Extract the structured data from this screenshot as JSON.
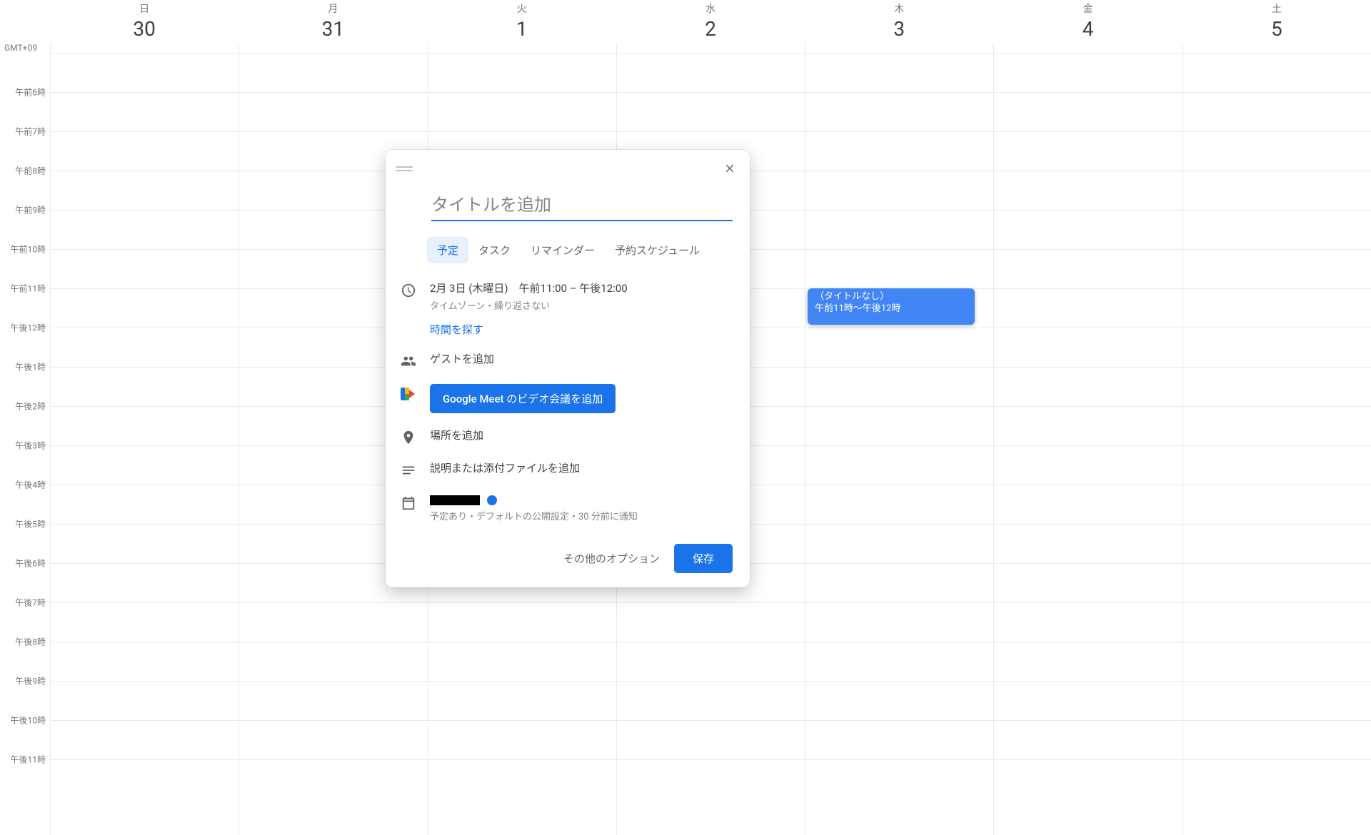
{
  "timezone_label": "GMT+09",
  "days": [
    {
      "dow": "日",
      "num": "30"
    },
    {
      "dow": "月",
      "num": "31"
    },
    {
      "dow": "火",
      "num": "1"
    },
    {
      "dow": "水",
      "num": "2"
    },
    {
      "dow": "木",
      "num": "3"
    },
    {
      "dow": "金",
      "num": "4"
    },
    {
      "dow": "土",
      "num": "5"
    }
  ],
  "hour_labels": [
    "午前6時",
    "午前7時",
    "午前8時",
    "午前9時",
    "午前10時",
    "午前11時",
    "午後12時",
    "午後1時",
    "午後2時",
    "午後3時",
    "午後4時",
    "午後5時",
    "午後6時",
    "午後7時",
    "午後8時",
    "午後9時",
    "午後10時",
    "午後11時"
  ],
  "event": {
    "title": "（タイトルなし）",
    "time": "午前11時～午後12時"
  },
  "popup": {
    "title_placeholder": "タイトルを追加",
    "tabs": [
      "予定",
      "タスク",
      "リマインダー",
      "予約スケジュール"
    ],
    "date_line": "2月 3日 (木曜日)　午前11:00  –  午後12:00",
    "date_sub": "タイムゾーン・繰り返さない",
    "find_time": "時間を探す",
    "guests": "ゲストを追加",
    "meet_button": "Google Meet のビデオ会議を追加",
    "location": "場所を追加",
    "description": "説明または添付ファイルを追加",
    "calendar_sub": "予定あり・デフォルトの公開設定・30 分前に通知",
    "more_options": "その他のオプション",
    "save": "保存"
  }
}
